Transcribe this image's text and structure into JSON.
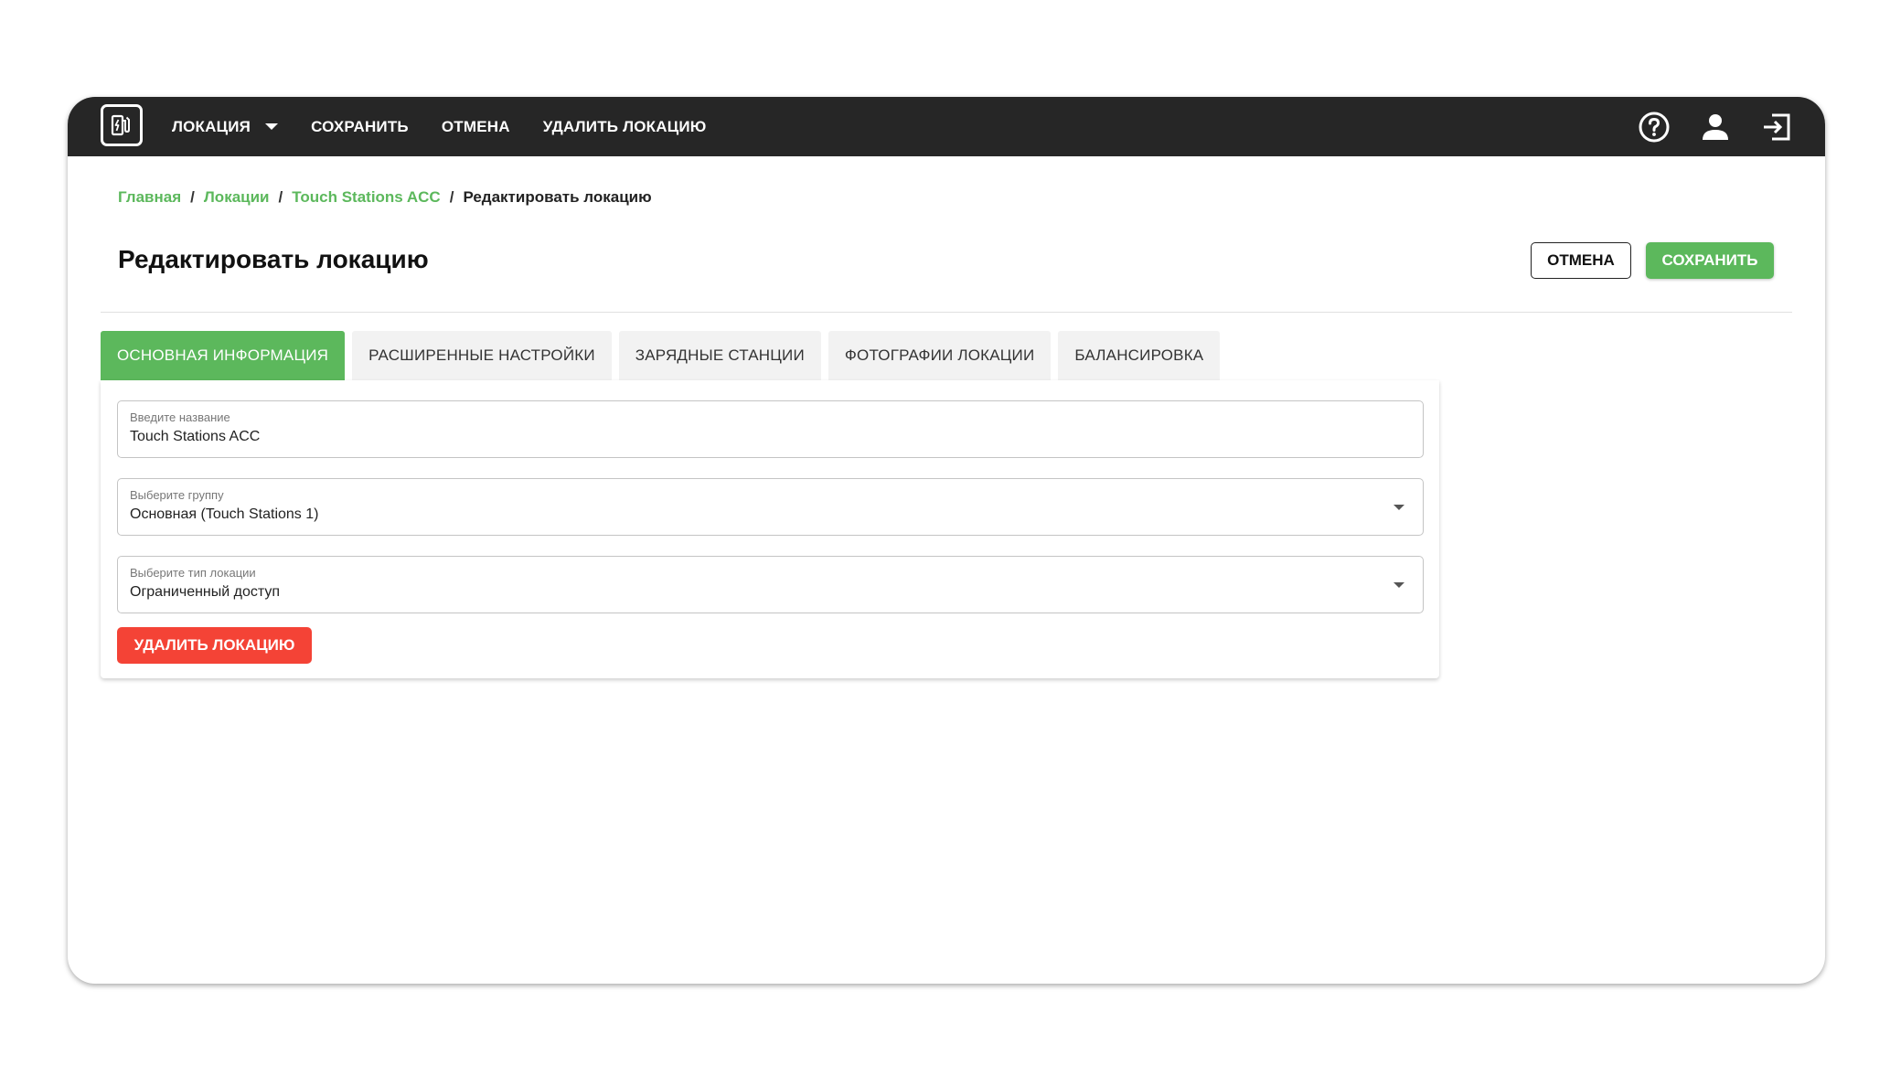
{
  "topbar": {
    "logo_icon": "ev-station-icon",
    "nav": {
      "location": "ЛОКАЦИЯ",
      "save": "СОХРАНИТЬ",
      "cancel": "ОТМЕНА",
      "delete": "УДАЛИТЬ ЛОКАЦИЮ"
    },
    "icons": [
      "help-icon",
      "user-icon",
      "logout-icon"
    ]
  },
  "breadcrumb": {
    "items": [
      "Главная",
      "Локации",
      "Touch Stations ACC"
    ],
    "current": "Редактировать локацию"
  },
  "page": {
    "title": "Редактировать локацию",
    "cancel_label": "ОТМЕНА",
    "save_label": "СОХРАНИТЬ"
  },
  "tabs": [
    {
      "label": "ОСНОВНАЯ ИНФОРМАЦИЯ",
      "active": true
    },
    {
      "label": "РАСШИРЕННЫЕ НАСТРОЙКИ",
      "active": false
    },
    {
      "label": "ЗАРЯДНЫЕ СТАНЦИИ",
      "active": false
    },
    {
      "label": "ФОТОГРАФИИ ЛОКАЦИИ",
      "active": false
    },
    {
      "label": "БАЛАНСИРОВКА",
      "active": false
    }
  ],
  "form": {
    "name": {
      "label": "Введите название",
      "value": "Touch Stations ACC"
    },
    "group": {
      "label": "Выберите группу",
      "value": "Основная (Touch Stations 1)"
    },
    "type": {
      "label": "Выберите тип локации",
      "value": "Ограниченный доступ"
    },
    "delete_label": "УДАЛИТЬ ЛОКАЦИЮ"
  },
  "colors": {
    "topbar": "#262626",
    "accent_green": "#5cb85c",
    "danger_red": "#f44336"
  }
}
